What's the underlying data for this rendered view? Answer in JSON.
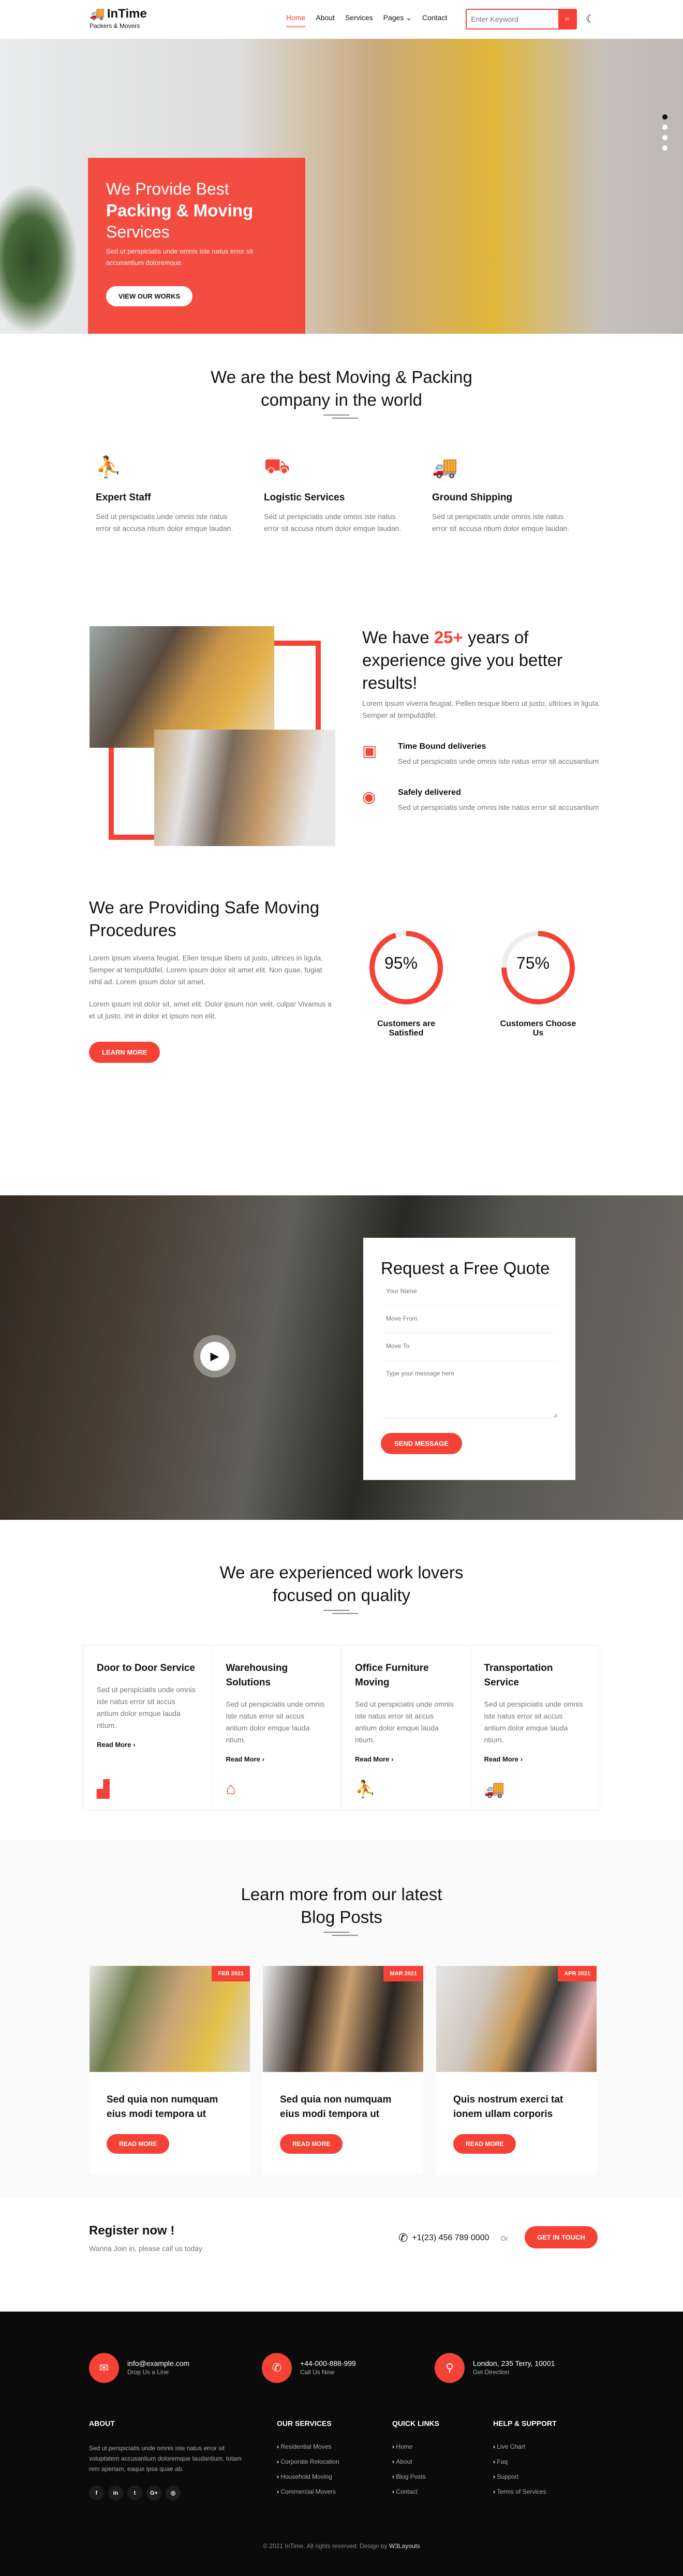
{
  "brand": {
    "name": "InTime",
    "tagline": "Packers & Movers",
    "accent": "#f44236"
  },
  "nav": {
    "items": [
      {
        "label": "Home",
        "active": true
      },
      {
        "label": "About"
      },
      {
        "label": "Services"
      },
      {
        "label": "Pages"
      },
      {
        "label": "Contact"
      }
    ],
    "search_placeholder": "Enter Keyword"
  },
  "hero": {
    "line1": "We Provide Best",
    "line2": "Packing & Moving",
    "line3": "Services",
    "text": "Sed ut perspiciatis unde omnis iste natus error sit accusantium doloremque.",
    "button": "VIEW OUR WORKS",
    "slides": 4,
    "active_slide": 1
  },
  "best": {
    "title_line1": "We are the best Moving & Packing",
    "title_line2": "company in the world",
    "features": [
      {
        "icon": "people-carry-icon",
        "title": "Expert Staff",
        "text": "Sed ut perspiciatis unde omnis iste natus error sit accusa ntium dolor emque laudan."
      },
      {
        "icon": "hand-truck-icon",
        "title": "Logistic Services",
        "text": "Sed ut perspiciatis unde omnis iste natus error sit accusa ntium dolor emque laudan."
      },
      {
        "icon": "truck-icon",
        "title": "Ground Shipping",
        "text": "Sed ut perspiciatis unde omnis iste natus error sit accusa ntium dolor emque laudan."
      }
    ]
  },
  "experience": {
    "title_pre": "We have ",
    "title_num": "25+",
    "title_post": " years of experience give you better results!",
    "lead": "Lorem ipsum viverra feugiat. Pellen tesque libero ut justo, ultrices in ligula. Semper at tempufddfel.",
    "items": [
      {
        "icon": "box-open-icon",
        "title": "Time Bound deliveries",
        "text": "Sed ut perspiciatis unde omnis iste natus error sit accusantium"
      },
      {
        "icon": "tape-icon",
        "title": "Safely delivered",
        "text": "Sed ut perspiciatis unde omnis iste natus error sit accusantium"
      }
    ]
  },
  "safe": {
    "title": "We are Providing Safe Moving Procedures",
    "p1": "Lorem ipsum viverra feugiat. Ellen tesque libero ut justo, ultrices in ligula. Semper at tempufddfel. Lorem ipsum dolor sit amet elit. Non quae, fugiat nihil ad. Lorem ipsum dolor sit amet.",
    "p2": "Lorem ipsum init dolor sit, amet elit. Dolor ipsum non velit, culpa! Vivamus a et ut justo, init in dolor et ipsum non elit.",
    "button": "LEARN MORE",
    "stats": [
      {
        "percent": 95,
        "label_value": "95%",
        "label": "Customers are Satisfied"
      },
      {
        "percent": 75,
        "label_value": "75%",
        "label": "Customers Choose Us"
      }
    ]
  },
  "quote": {
    "title": "Request a Free Quote",
    "name_ph": "Your Name",
    "from_ph": "Move From",
    "to_ph": "Move To",
    "msg_ph": "Type your message here",
    "button": "SEND MESSAGE"
  },
  "services": {
    "title_line1": "We are experienced work lovers",
    "title_line2": "focused on quality",
    "cards": [
      {
        "title": "Door to Door Service",
        "text": "Sed ut perspiciatis unde omnis iste natus error sit accus antium dolor emque lauda ntium.",
        "link": "Read More ›",
        "icon": "door-icon"
      },
      {
        "title": "Warehousing Solutions",
        "text": "Sed ut perspiciatis unde omnis iste natus error sit accus antium dolor emque lauda ntium.",
        "link": "Read More ›",
        "icon": "warehouse-icon"
      },
      {
        "title": "Office Furniture Moving",
        "text": "Sed ut perspiciatis unde omnis iste natus error sit accus antium dolor emque lauda ntium.",
        "link": "Read More ›",
        "icon": "people-carry-icon"
      },
      {
        "title": "Transportation Service",
        "text": "Sed ut perspiciatis unde omnis iste natus error sit accus antium dolor emque lauda ntium.",
        "link": "Read More ›",
        "icon": "truck-icon"
      }
    ]
  },
  "blog": {
    "title_line1": "Learn more from our latest",
    "title_line2": "Blog Posts",
    "posts": [
      {
        "date": "FEB 2021",
        "title": "Sed quia non numquam eius modi tempora ut",
        "button": "READ MORE"
      },
      {
        "date": "MAR 2021",
        "title": "Sed quia non numquam eius modi tempora ut",
        "button": "READ MORE"
      },
      {
        "date": "APR 2021",
        "title": "Quis nostrum exerci tat ionem ullam corporis",
        "button": "READ MORE"
      }
    ]
  },
  "register": {
    "title": "Register now !",
    "sub": "Wanna Join in, please call us today",
    "phone": "+1(23) 456 789 0000",
    "or": "Or",
    "button": "GET IN TOUCH"
  },
  "footer": {
    "contacts": [
      {
        "icon": "envelope-open-icon",
        "main": "info@example.com",
        "sub": "Drop Us a Line"
      },
      {
        "icon": "phone-icon",
        "main": "+44-000-888-999",
        "sub": "Call Us Now"
      },
      {
        "icon": "map-marker-icon",
        "main": "London, 235 Terry, 10001",
        "sub": "Get Direction"
      }
    ],
    "about_title": "ABOUT",
    "about_text": "Sed ut perspiciatis unde omnis iste natus error sit voluptatem accusantium doloremque laudantium, totam rem aperiam, eaque ipsa quae ab.",
    "social": [
      {
        "icon": "facebook-icon",
        "glyph": "f"
      },
      {
        "icon": "linkedin-icon",
        "glyph": "in"
      },
      {
        "icon": "twitter-icon",
        "glyph": "t"
      },
      {
        "icon": "google-plus-icon",
        "glyph": "G+"
      },
      {
        "icon": "instagram-icon",
        "glyph": "◎"
      }
    ],
    "columns": [
      {
        "title": "OUR SERVICES",
        "links": [
          "Residential Moves",
          "Corporate Relocation",
          "Household Moving",
          "Commercial Movers"
        ]
      },
      {
        "title": "QUICK LINKS",
        "links": [
          "Home",
          "About",
          "Blog Posts",
          "Contact"
        ]
      },
      {
        "title": "HELP & SUPPORT",
        "links": [
          "Live Chart",
          "Faq",
          "Support",
          "Terms of Services"
        ]
      }
    ],
    "copyright": "© 2021 InTime. All rights reserved. Design by",
    "designer": "W3Layouts"
  }
}
